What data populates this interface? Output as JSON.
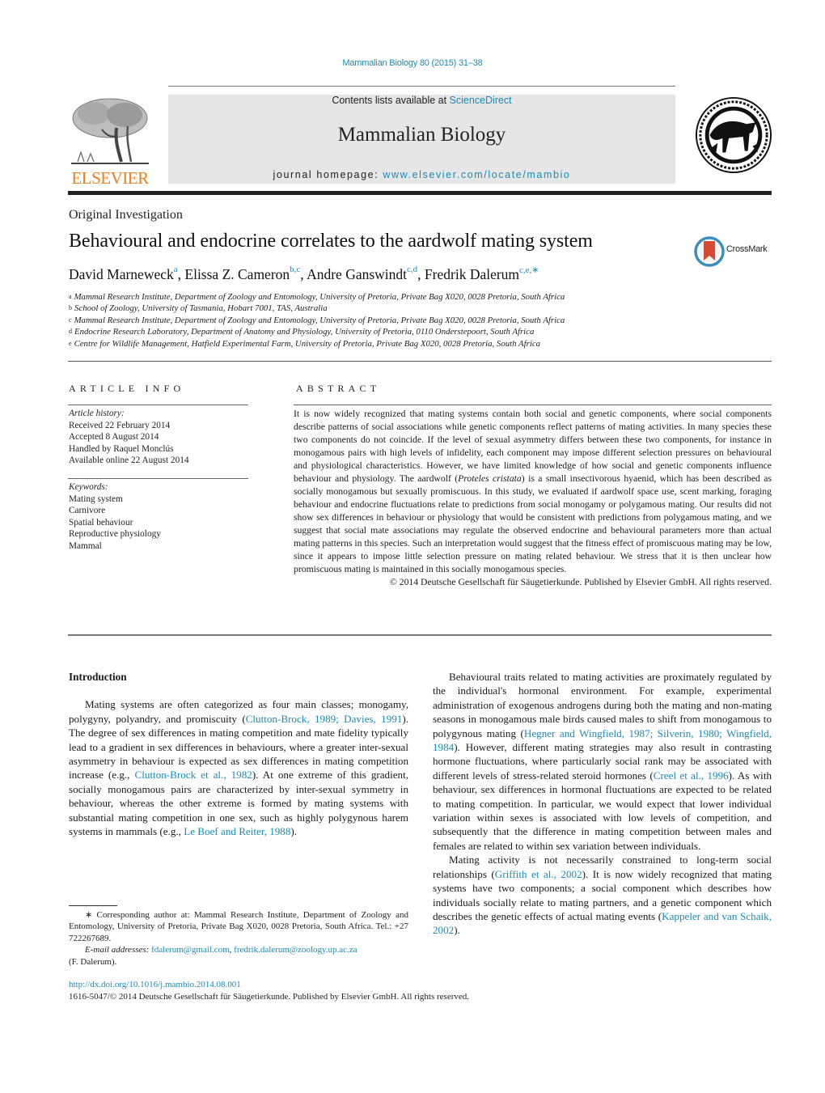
{
  "header": {
    "journal_ref": "Mammalian Biology 80 (2015) 31–38",
    "contents_prefix": "Contents lists available at ",
    "contents_link": "ScienceDirect",
    "journal_name": "Mammalian Biology",
    "homepage_prefix": "journal homepage: ",
    "homepage_link": "www.elsevier.com/locate/mambio",
    "publisher_logo_text": "ELSEVIER",
    "publisher_color": "#f07c1e",
    "link_color": "#1a8bb8"
  },
  "article": {
    "type": "Original Investigation",
    "title": "Behavioural and endocrine correlates to the aardwolf mating system",
    "crossmark_label": "CrossMark",
    "authors": [
      {
        "name": "David Marneweck",
        "sup": "a",
        "sep": ", "
      },
      {
        "name": "Elissa Z. Cameron",
        "sup": "b,c",
        "sep": ", "
      },
      {
        "name": "Andre Ganswindt",
        "sup": "c,d",
        "sep": ", "
      },
      {
        "name": "Fredrik Dalerum",
        "sup": "c,e,∗",
        "sep": ""
      }
    ],
    "affiliations": [
      {
        "key": "a",
        "text": "Mammal Research Institute, Department of Zoology and Entomology, University of Pretoria, Private Bag X020, 0028 Pretoria, South Africa"
      },
      {
        "key": "b",
        "text": "School of Zoology, University of Tasmania, Hobart 7001, TAS, Australia"
      },
      {
        "key": "c",
        "text": "Mammal Research Institute, Department of Zoology and Entomology, University of Pretoria, Private Bag X020, 0028 Pretoria, South Africa"
      },
      {
        "key": "d",
        "text": "Endocrine Research Laboratory, Department of Anatomy and Physiology, University of Pretoria, 0110 Onderstepoort, South Africa"
      },
      {
        "key": "e",
        "text": "Centre for Wildlife Management, Hatfield Experimental Farm, University of Pretoria, Private Bag X020, 0028 Pretoria, South Africa"
      }
    ]
  },
  "article_info": {
    "heading": "ARTICLE INFO",
    "history_label": "Article history:",
    "history": [
      "Received 22 February 2014",
      "Accepted 8 August 2014",
      "Handled by Raquel Monclús",
      "Available online 22 August 2014"
    ],
    "keywords_label": "Keywords:",
    "keywords": [
      "Mating system",
      "Carnivore",
      "Spatial behaviour",
      "Reproductive physiology",
      "Mammal"
    ]
  },
  "abstract": {
    "heading": "ABSTRACT",
    "text_before_italic": "It is now widely recognized that mating systems contain both social and genetic components, where social components describe patterns of social associations while genetic components reflect patterns of mating activities. In many species these two components do not coincide. If the level of sexual asymmetry differs between these two components, for instance in monogamous pairs with high levels of infidelity, each component may impose different selection pressures on behavioural and physiological characteristics. However, we have limited knowledge of how social and genetic components influence behaviour and physiology. The aardwolf (",
    "italic": "Proteles cristata",
    "text_after_italic": ") is a small insectivorous hyaenid, which has been described as socially monogamous but sexually promiscuous. In this study, we evaluated if aardwolf space use, scent marking, foraging behaviour and endocrine fluctuations relate to predictions from social monogamy or polygamous mating. Our results did not show sex differences in behaviour or physiology that would be consistent with predictions from polygamous mating, and we suggest that social mate associations may regulate the observed endocrine and behavioural parameters more than actual mating patterns in this species. Such an interpretation would suggest that the fitness effect of promiscuous mating may be low, since it appears to impose little selection pressure on mating related behaviour. We stress that it is then unclear how promiscuous mating is maintained in this socially monogamous species.",
    "copyright": "© 2014 Deutsche Gesellschaft für Säugetierkunde. Published by Elsevier GmbH. All rights reserved."
  },
  "body": {
    "intro_heading": "Introduction",
    "left_para1": {
      "t1": "Mating systems are often categorized as four main classes; monogamy, polygyny, polyandry, and promiscuity (",
      "c1": "Clutton-Brock, 1989; Davies, 1991",
      "t2": "). The degree of sex differences in mating competition and mate fidelity typically lead to a gradient in sex differences in behaviours, where a greater inter-sexual asymmetry in behaviour is expected as sex differences in mating competition increase (e.g., ",
      "c2": "Clutton-Brock et al., 1982",
      "t3": "). At one extreme of this gradient, socially monogamous pairs are characterized by inter-sexual symmetry in behaviour, whereas the other extreme is formed by mating systems with substantial mating competition in one sex, such as highly polygynous harem systems in mammals (e.g., ",
      "c3": "Le Boef and Reiter, 1988",
      "t4": ")."
    },
    "right_para1": {
      "t1": "Behavioural traits related to mating activities are proximately regulated by the individual's hormonal environment. For example, experimental administration of exogenous androgens during both the mating and non-mating seasons in monogamous male birds caused males to shift from monogamous to polygynous mating (",
      "c1": "Hegner and Wingfield, 1987; Silverin, 1980; Wingfield, 1984",
      "t2": "). However, different mating strategies may also result in contrasting hormone fluctuations, where particularly social rank may be associated with different levels of stress-related steroid hormones (",
      "c2": "Creel et al., 1996",
      "t3": "). As with behaviour, sex differences in hormonal fluctuations are expected to be related to mating competition. In particular, we would expect that lower individual variation within sexes is associated with low levels of competition, and subsequently that the difference in mating competition between males and females are related to within sex variation between individuals."
    },
    "right_para2": {
      "t1": "Mating activity is not necessarily constrained to long-term social relationships (",
      "c1": "Griffith et al., 2002",
      "t2": "). It is now widely recognized that mating systems have two components; a social component which describes how individuals socially relate to mating partners, and a genetic component which describes the genetic effects of actual mating events (",
      "c2": "Kappeler and van Schaik, 2002",
      "t3": ")."
    }
  },
  "footnote": {
    "marker": "∗",
    "text": "Corresponding author at: Mammal Research Institute, Department of Zoology and Entomology, University of Pretoria, Private Bag X020, 0028 Pretoria, South Africa. Tel.: +27 722267689.",
    "email_label": "E-mail addresses:",
    "email1": "fdalerum@gmail.com",
    "email_sep": ", ",
    "email2": "fredrik.dalerum@zoology.up.ac.za",
    "owner": "(F. Dalerum)."
  },
  "footer": {
    "doi": "http://dx.doi.org/10.1016/j.mambio.2014.08.001",
    "issn_copyright": "1616-5047/© 2014 Deutsche Gesellschaft für Säugetierkunde. Published by Elsevier GmbH. All rights reserved."
  }
}
